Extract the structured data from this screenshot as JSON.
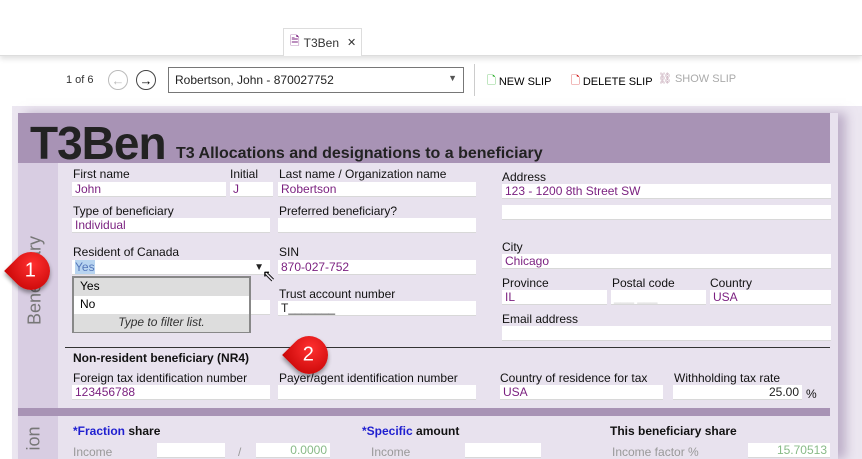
{
  "tab": {
    "title": "T3Ben",
    "close": "✕"
  },
  "toolbar": {
    "position": "1 of 6",
    "record": "Robertson, John - 870027752",
    "new_slip": "NEW SLIP",
    "delete_slip": "DELETE SLIP",
    "show_slip": "SHOW SLIP"
  },
  "form": {
    "code": "T3Ben",
    "title": "T3 Allocations and designations to a beneficiary",
    "section": "Beneficiary",
    "section2": "ion",
    "first_name": {
      "label": "First name",
      "value": "John"
    },
    "initial": {
      "label": "Initial",
      "value": "J"
    },
    "last_name": {
      "label": "Last name / Organization name",
      "value": "Robertson"
    },
    "type": {
      "label": "Type of beneficiary",
      "value": "Individual"
    },
    "preferred": {
      "label": "Preferred beneficiary?",
      "value": ""
    },
    "resident": {
      "label": "Resident of Canada",
      "value": "Yes",
      "options": [
        "Yes",
        "No"
      ],
      "hint": "Type to filter list."
    },
    "sin": {
      "label": "SIN",
      "value": "870-027-752"
    },
    "trust": {
      "label": "Trust account number",
      "value": "T_______"
    },
    "address": {
      "label": "Address",
      "value": "123 - 1200 8th Street SW",
      "value2": ""
    },
    "city": {
      "label": "City",
      "value": "Chicago"
    },
    "province": {
      "label": "Province",
      "value": "IL"
    },
    "postal": {
      "label": "Postal code",
      "value": "___ ___"
    },
    "country": {
      "label": "Country",
      "value": "USA"
    },
    "email": {
      "label": "Email address",
      "value": ""
    },
    "nr4": {
      "heading": "Non-resident beneficiary (NR4)",
      "foreign_tin": {
        "label": "Foreign tax identification number",
        "value": "123456788"
      },
      "payer": {
        "label": "Payer/agent identification number",
        "value": ""
      },
      "country_tax": {
        "label": "Country of residence for tax",
        "value": "USA"
      },
      "withholding": {
        "label": "Withholding tax rate",
        "value": "25.00",
        "unit": "%"
      }
    },
    "share": {
      "fraction_star": "*Fraction",
      "fraction_rest": " share",
      "specific_star": "*Specific",
      "specific_rest": " amount",
      "this_share": "This beneficiary share",
      "income1": "Income",
      "slash": "/",
      "fraction_value": "0.0000",
      "income2": "Income",
      "income_factor": "Income factor %",
      "factor_value": "15.70513"
    }
  },
  "callouts": [
    "1",
    "2"
  ]
}
